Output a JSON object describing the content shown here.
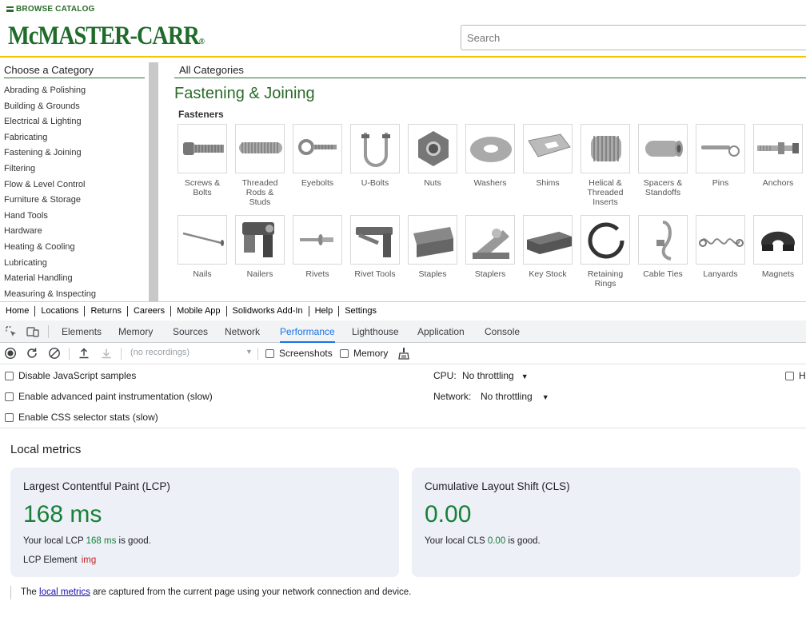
{
  "site": {
    "browse_label": "BROWSE CATALOG",
    "logo_text": "McMASTER-CARR",
    "logo_reg": "®",
    "search_placeholder": "Search",
    "category_panel_title": "Choose a Category",
    "categories": [
      "Abrading & Polishing",
      "Building & Grounds",
      "Electrical & Lighting",
      "Fabricating",
      "Fastening & Joining",
      "Filtering",
      "Flow & Level Control",
      "Furniture & Storage",
      "Hand Tools",
      "Hardware",
      "Heating & Cooling",
      "Lubricating",
      "Material Handling",
      "Measuring & Inspecting"
    ],
    "all_categories": "All Categories",
    "section_title": "Fastening & Joining",
    "subsection_title": "Fasteners",
    "products_row1": [
      {
        "label": "Screws &\nBolts",
        "icon": "screw-icon"
      },
      {
        "label": "Threaded\nRods &\nStuds",
        "icon": "threaded-rod-icon"
      },
      {
        "label": "Eyebolts",
        "icon": "eyebolt-icon"
      },
      {
        "label": "U-Bolts",
        "icon": "u-bolt-icon"
      },
      {
        "label": "Nuts",
        "icon": "nut-icon"
      },
      {
        "label": "Washers",
        "icon": "washer-icon"
      },
      {
        "label": "Shims",
        "icon": "shim-icon"
      },
      {
        "label": "Helical &\nThreaded\nInserts",
        "icon": "insert-icon"
      },
      {
        "label": "Spacers &\nStandoffs",
        "icon": "spacer-icon"
      },
      {
        "label": "Pins",
        "icon": "pin-icon"
      },
      {
        "label": "Anchors",
        "icon": "anchor-icon"
      }
    ],
    "products_row2": [
      {
        "label": "Nails",
        "icon": "nail-icon"
      },
      {
        "label": "Nailers",
        "icon": "nailer-icon"
      },
      {
        "label": "Rivets",
        "icon": "rivet-icon"
      },
      {
        "label": "Rivet Tools",
        "icon": "rivet-tool-icon"
      },
      {
        "label": "Staples",
        "icon": "staples-icon"
      },
      {
        "label": "Staplers",
        "icon": "stapler-icon"
      },
      {
        "label": "Key Stock",
        "icon": "key-stock-icon"
      },
      {
        "label": "Retaining\nRings",
        "icon": "retaining-ring-icon"
      },
      {
        "label": "Cable Ties",
        "icon": "cable-tie-icon"
      },
      {
        "label": "Lanyards",
        "icon": "lanyard-icon"
      },
      {
        "label": "Magnets",
        "icon": "magnet-icon"
      }
    ],
    "bottom_nav": [
      "Home",
      "Locations",
      "Returns",
      "Careers",
      "Mobile App",
      "Solidworks Add-In",
      "Help",
      "Settings"
    ]
  },
  "devtools": {
    "tabs": [
      "Elements",
      "Memory",
      "Sources",
      "Network",
      "Performance",
      "Lighthouse",
      "Application",
      "Console"
    ],
    "active_tab": "Performance",
    "recordings_placeholder": "(no recordings)",
    "toolbar_checkboxes": [
      "Screenshots",
      "Memory"
    ],
    "settings": {
      "disable_js_samples": "Disable JavaScript samples",
      "advanced_paint": "Enable advanced paint instrumentation (slow)",
      "css_selector_stats": "Enable CSS selector stats (slow)",
      "cpu_label": "CPU:",
      "cpu_value": "No throttling",
      "network_label": "Network:",
      "network_value": "No throttling",
      "hardware_partial": "H"
    },
    "metrics_title": "Local metrics",
    "lcp": {
      "title": "Largest Contentful Paint (LCP)",
      "value": "168 ms",
      "desc_prefix": "Your local LCP ",
      "desc_value": "168 ms",
      "desc_suffix": " is good.",
      "element_label": "LCP Element",
      "element_value": "img"
    },
    "cls": {
      "title": "Cumulative Layout Shift (CLS)",
      "value": "0.00",
      "desc_prefix": "Your local CLS ",
      "desc_value": "0.00",
      "desc_suffix": " is good."
    },
    "footnote_prefix": "The ",
    "footnote_link": "local metrics",
    "footnote_suffix": " are captured from the current page using your network connection and device.",
    "colors": {
      "accent": "#1a73e8",
      "good": "#188038",
      "brand": "#1e6b2a",
      "brand_line": "#f2c500"
    }
  }
}
